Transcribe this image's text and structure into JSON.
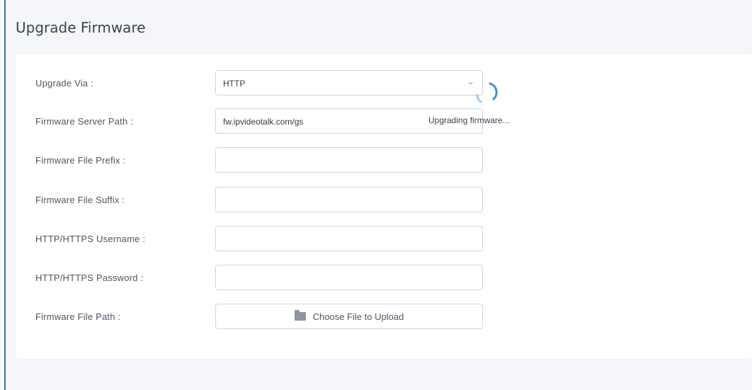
{
  "page": {
    "title": "Upgrade Firmware"
  },
  "form": {
    "rows": [
      {
        "label": "Upgrade Via :",
        "type": "select",
        "value": "HTTP",
        "icon": "chevron-down-icon"
      },
      {
        "label": "Firmware Server Path :",
        "type": "text",
        "value": "fw.ipvideotalk.com/gs"
      },
      {
        "label": "Firmware File Prefix :",
        "type": "text",
        "value": ""
      },
      {
        "label": "Firmware File Suffix :",
        "type": "text",
        "value": ""
      },
      {
        "label": "HTTP/HTTPS Username :",
        "type": "text",
        "value": ""
      },
      {
        "label": "HTTP/HTTPS Password :",
        "type": "password",
        "value": ""
      },
      {
        "label": "Firmware File Path :",
        "type": "upload",
        "button_label": "Choose File to Upload",
        "icon": "folder-icon"
      }
    ]
  },
  "status": {
    "text": "Upgrading firmware...",
    "icon": "spinner-icon"
  },
  "colors": {
    "accent": "#3d8fd6",
    "frame": "#3d6fb0"
  }
}
